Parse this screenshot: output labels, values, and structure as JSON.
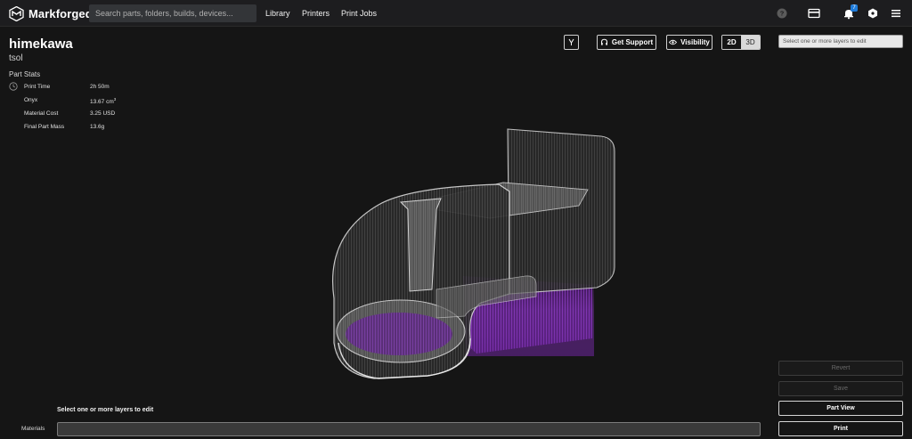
{
  "header": {
    "brand": "Markforged",
    "search_placeholder": "Search parts, folders, builds, devices...",
    "nav": [
      "Library",
      "Printers",
      "Print Jobs"
    ],
    "notification_count": "7",
    "icons": [
      "help-icon",
      "display-icon",
      "bell-icon",
      "hexagon-icon",
      "menu-icon"
    ]
  },
  "part": {
    "name": "himekawa",
    "owner": "tsol"
  },
  "stats": {
    "title": "Part Stats",
    "print_time_label": "Print Time",
    "print_time_value": "2h 50m",
    "onyx_label": "Onyx",
    "onyx_value": "13.67 cm",
    "onyx_unit_sup": "3",
    "cost_label": "Material Cost",
    "cost_value": "3.25 USD",
    "mass_label": "Final Part Mass",
    "mass_value": "13.6g"
  },
  "toolbar": {
    "support_label": "Get Support",
    "visibility_label": "Visibility",
    "mode_2d": "2D",
    "mode_3d": "3D",
    "active_mode": "2D",
    "layer_placeholder": "Select one or more layers to edit"
  },
  "actions": {
    "revert": "Revert",
    "save": "Save",
    "part_view": "Part View",
    "print": "Print"
  },
  "bottom": {
    "hint": "Select one or more layers to edit",
    "materials_label": "Materials"
  },
  "colors": {
    "accent_purple": "#9a3cd6",
    "badge_blue": "#1f7bd9",
    "background": "#151515"
  }
}
